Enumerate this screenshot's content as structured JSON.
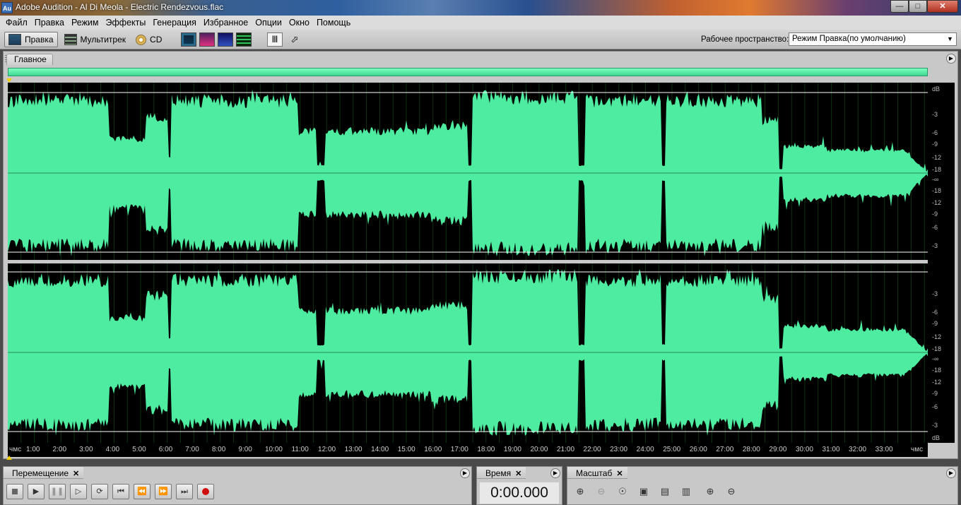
{
  "window": {
    "app_icon": "Au",
    "title": "Adobe Audition - Al Di Meola - Electric Rendezvous.flac",
    "buttons": [
      "minimize-icon",
      "maximize-icon",
      "close-icon"
    ]
  },
  "menu": [
    "Файл",
    "Правка",
    "Режим",
    "Эффекты",
    "Генерация",
    "Избранное",
    "Опции",
    "Окно",
    "Помощь"
  ],
  "toolbar": {
    "modes": [
      {
        "label": "Правка",
        "icon": "edit-view-icon"
      },
      {
        "label": "Мультитрек",
        "icon": "multitrack-icon"
      },
      {
        "label": "CD",
        "icon": "cd-icon"
      }
    ],
    "view_buttons": [
      "waveform-view-icon",
      "spectral-view-icon",
      "pan-view-icon",
      "phase-view-icon"
    ],
    "tools": [
      "time-selection-tool-icon",
      "marquee-tool-icon"
    ],
    "workspace_label": "Рабочее пространство:",
    "workspace_value": "Режим Правка(по умолчанию)"
  },
  "main_panel": {
    "tab": "Главное",
    "db_top": "dB",
    "db_bottom": "dB",
    "channel_db_labels": [
      "-3",
      "-6",
      "-9",
      "-12",
      "-18",
      "-∞",
      "-18",
      "-12",
      "-9",
      "-6",
      "-3"
    ],
    "channel2_db_labels": [
      "-3",
      "-6",
      "-9",
      "-12",
      "-18",
      "-∞",
      "-18",
      "-12",
      "-9",
      "-6",
      "-3"
    ],
    "time_unit_left": "чмс",
    "time_unit_right": "чмс",
    "time_labels": [
      "1:00",
      "2:00",
      "3:00",
      "4:00",
      "5:00",
      "6:00",
      "7:00",
      "8:00",
      "9:00",
      "10:00",
      "11:00",
      "12:00",
      "13:00",
      "14:00",
      "15:00",
      "16:00",
      "17:00",
      "18:00",
      "19:00",
      "20:00",
      "21:00",
      "22:00",
      "23:00",
      "24:00",
      "25:00",
      "26:00",
      "27:00",
      "28:00",
      "29:00",
      "30:00",
      "31:00",
      "32:00",
      "33:00"
    ],
    "waveform_color": "#4eeca0"
  },
  "transport": {
    "tab": "Перемещение",
    "buttons": [
      "stop-icon",
      "play-icon",
      "pause-icon",
      "play-from-cursor-icon",
      "loop-icon",
      "go-to-start-icon",
      "rewind-icon",
      "fast-forward-icon",
      "go-to-end-icon",
      "record-icon"
    ]
  },
  "time_panel": {
    "tab": "Время",
    "value": "0:00.000"
  },
  "zoom_panel": {
    "tab": "Масштаб",
    "buttons": [
      "zoom-in-horizontal-icon",
      "zoom-out-horizontal-icon",
      "zoom-full-icon",
      "zoom-selection-icon",
      "zoom-left-edge-icon",
      "zoom-right-edge-icon",
      "zoom-in-vertical-icon",
      "zoom-out-vertical-icon"
    ]
  }
}
